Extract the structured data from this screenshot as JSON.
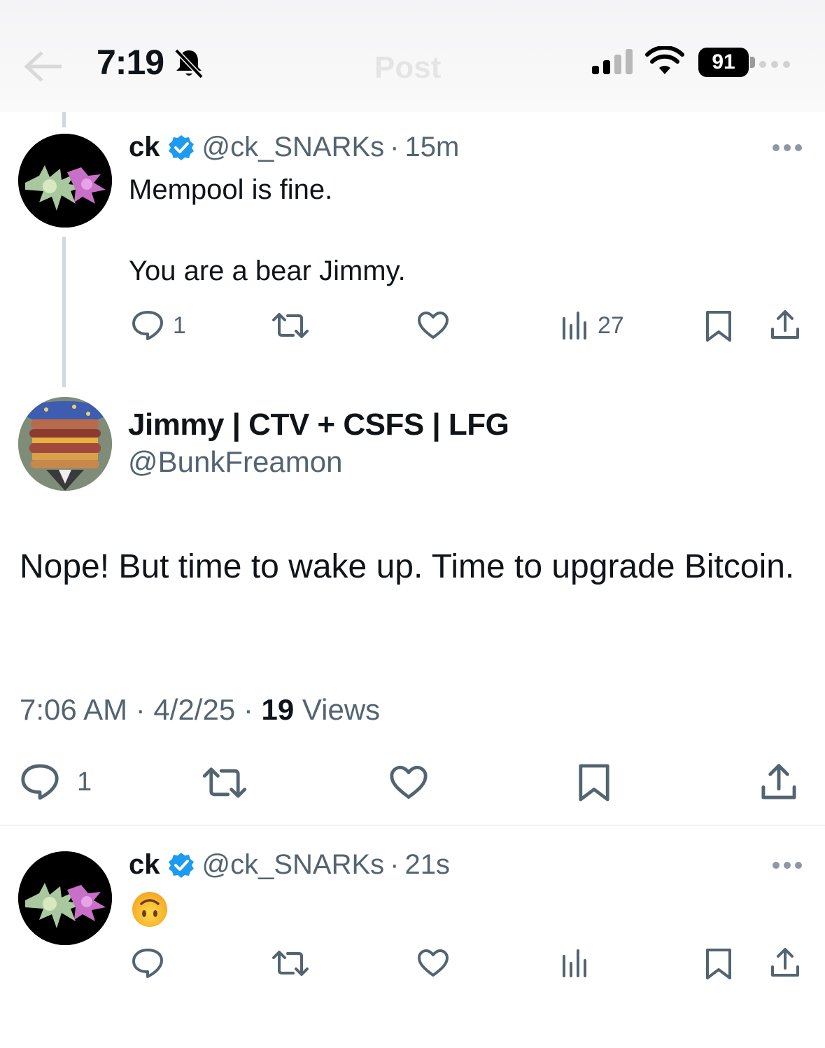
{
  "status_bar": {
    "time": "7:19",
    "battery": "91",
    "ghost_title": "Post"
  },
  "thread": [
    {
      "name": "ck",
      "handle": "@ck_SNARKs",
      "separator": "·",
      "time_ago": "15m",
      "text_lines": [
        "Mempool is fine.",
        "You are a bear Jimmy."
      ],
      "replies": "1",
      "views": "27"
    }
  ],
  "main_post": {
    "name": "Jimmy | CTV + CSFS | LFG",
    "handle": "@BunkFreamon",
    "text": "Nope! But time to wake up. Time to upgrade Bitcoin.",
    "timestamp": "7:06 AM · 4/2/25 · ",
    "views_count": "19",
    "views_label": " Views",
    "replies": "1"
  },
  "reply": {
    "name": "ck",
    "handle": "@ck_SNARKs",
    "separator": "·",
    "time_ago": "21s",
    "emoji": "upside-down-face"
  },
  "icons": {
    "verified": "verified-badge-icon",
    "reply": "reply-icon",
    "retweet": "retweet-icon",
    "like": "heart-icon",
    "views": "views-icon",
    "bookmark": "bookmark-icon",
    "share": "share-icon"
  },
  "colors": {
    "verified_blue": "#1d9bf0",
    "text_primary": "#0f1419",
    "text_secondary": "#536471",
    "thread_line": "#cfd9de"
  }
}
